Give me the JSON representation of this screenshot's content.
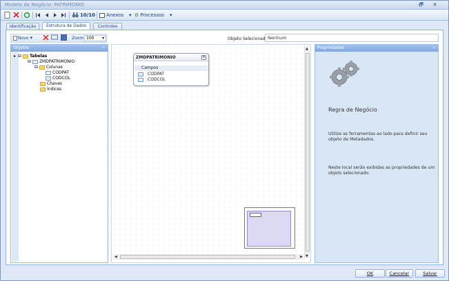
{
  "window": {
    "title": "Modelo de Negócio: PATRIMONIO",
    "restore_glyph": "🗗",
    "close_glyph": "✕"
  },
  "toolbar": {
    "page_counter": "10/10",
    "anexos_label": "Anexos",
    "processos_label": "Processos"
  },
  "tabs": [
    {
      "label": "Identificação"
    },
    {
      "label": "Estrutura de Dados",
      "active": true
    },
    {
      "label": "Controles"
    }
  ],
  "inner_toolbar": {
    "novo_label": "Novo",
    "zoom_label": "Zoom",
    "zoom_value": "100"
  },
  "selected_object": {
    "label": "Objeto Selecionado:",
    "value": "Nenhum"
  },
  "objects_panel": {
    "title": "Objetos",
    "tree": {
      "root": "Tabelas",
      "table": "ZMDPATRIMONIO",
      "columns_folder": "Colunas",
      "columns": [
        "CODPAT",
        "CODCOL"
      ],
      "keys_folder": "Chaves",
      "indexes_folder": "Índices"
    }
  },
  "entity": {
    "name": "ZMDPATRIMONIO",
    "section": "Campos",
    "fields": [
      "CODPAT",
      "CODCOL"
    ]
  },
  "properties_panel": {
    "title": "Propriedades",
    "heading": "Regra de Negócio",
    "text1": "Utilize as ferramentas ao lado para definir seu objeto de Metadados.",
    "text2": "Neste local serão exibidas as propriedades de um objeto selecionado."
  },
  "footer": {
    "ok_label": "OK",
    "cancel_label": "Cancelar",
    "save_label": "Salvar"
  },
  "colors": {
    "accent": "#15428b",
    "panel_header": "#7fa7e1",
    "window_bg": "#dfe8f6"
  }
}
